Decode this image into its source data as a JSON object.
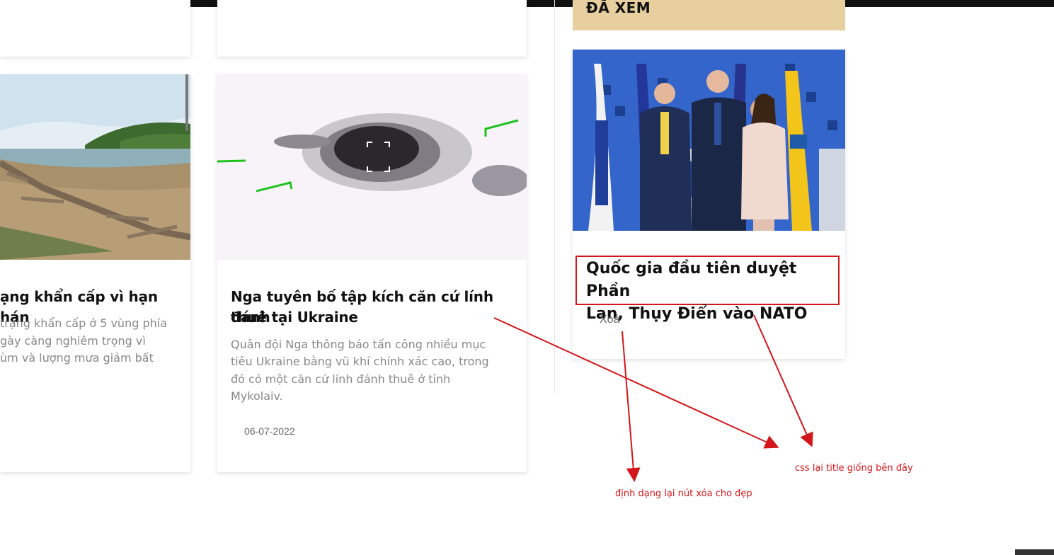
{
  "sidebar_header": {
    "title": "ĐÃ XEM"
  },
  "articles": [
    {
      "title_line1": "ạng khẩn cấp vì hạn hán",
      "excerpt_line1": "trạng khẩn cấp ở 5 vùng phía",
      "excerpt_line2": "gày càng nghiêm trọng vì",
      "excerpt_line3": "ùm và lượng mưa giảm bất"
    },
    {
      "title_line1": "Nga tuyên bố tập kích căn cứ lính đánh",
      "title_line2": "thuê tại Ukraine",
      "excerpt_line1": "Quân đội Nga thông báo tấn công nhiều mục",
      "excerpt_line2": "tiêu Ukraine bằng vũ khí chính xác cao, trong",
      "excerpt_line3": "đó có một căn cứ lính đánh thuê ở tỉnh",
      "excerpt_line4": "Mykolaiv.",
      "date": "06-07-2022"
    }
  ],
  "viewed": {
    "title_line1": "Quốc gia đầu tiên duyệt Phần",
    "title_line2": "Lan, Thụy Điển vào NATO",
    "delete_label": "Xoá"
  },
  "annotations": {
    "title_note": "css lại title giống bên đây",
    "delete_note": "định dạng lại nút xóa cho đẹp",
    "color": "#d3161a"
  }
}
